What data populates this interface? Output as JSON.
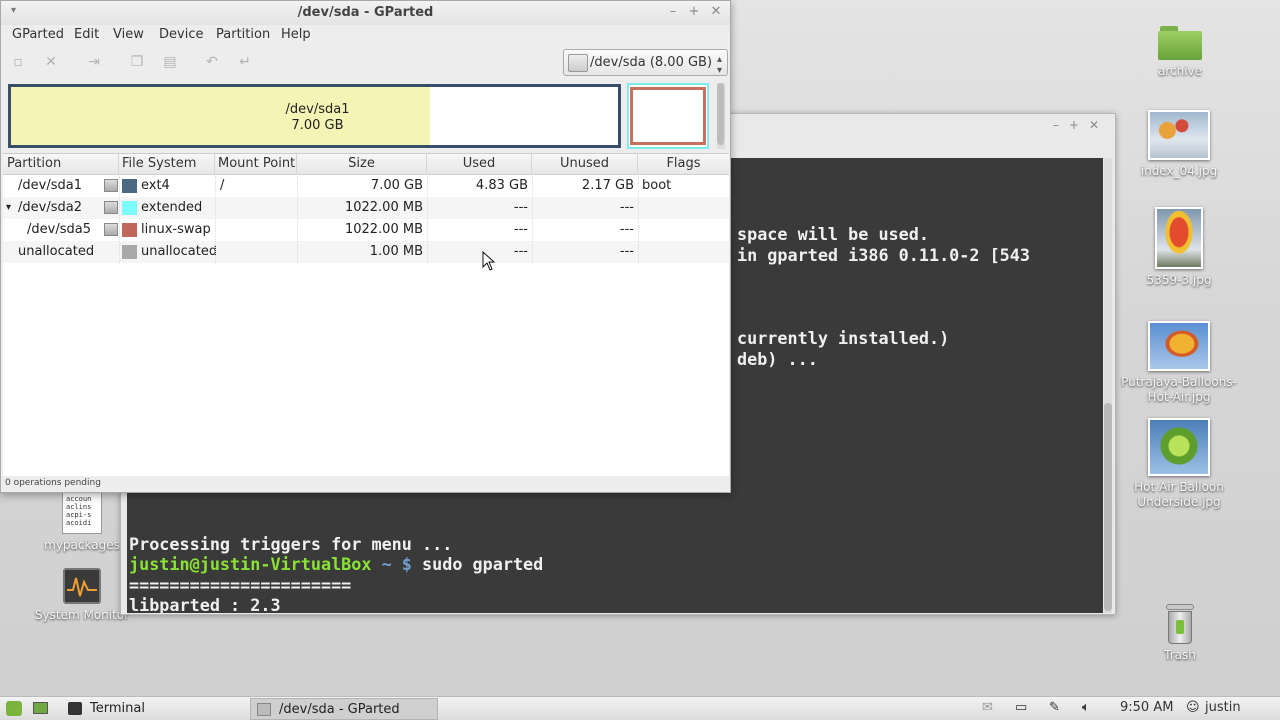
{
  "desktop": {
    "icons": [
      {
        "label": "archive",
        "icon": "folder-icon"
      },
      {
        "label": "index_04.jpg",
        "icon": "image-icon"
      },
      {
        "label": "5359-3.jpg",
        "icon": "image-icon"
      },
      {
        "label": "Putrajaya-Balloons-Hot-Air.jpg",
        "icon": "image-icon"
      },
      {
        "label": "Hot Air Balloon Underside.jpg",
        "icon": "image-icon"
      },
      {
        "label": "Trash",
        "icon": "trash-icon"
      },
      {
        "label": "mypackages",
        "icon": "text-file-icon"
      },
      {
        "label": "System Monitor",
        "icon": "system-monitor-icon"
      }
    ],
    "doc_thumb_lines": [
      "accoun",
      "aclins",
      "acpi-s",
      "acoidi"
    ]
  },
  "terminal": {
    "lines": [
      "space will be used.",
      "in gparted i386 0.11.0-2 [543",
      "",
      "currently installed.)",
      "deb) ..."
    ],
    "bottom_lines": [
      "Processing triggers for menu ...",
      "======================",
      "libparted : 2.3",
      "======================"
    ],
    "prompt_user": "justin@justin-VirtualBox",
    "prompt_path": "~ $",
    "prompt_command": " sudo gparted"
  },
  "gparted": {
    "title": "/dev/sda - GParted",
    "menu": [
      "GParted",
      "Edit",
      "View",
      "Device",
      "Partition",
      "Help"
    ],
    "device": "/dev/sda  (8.00 GB)",
    "map": {
      "sda1_name": "/dev/sda1",
      "sda1_size": "7.00 GB",
      "sda1_used_fraction": 0.69
    },
    "columns": [
      "Partition",
      "File System",
      "Mount Point",
      "Size",
      "Used",
      "Unused",
      "Flags"
    ],
    "rows": [
      {
        "partition": "/dev/sda1",
        "fs": "ext4",
        "fs_color": "#4b6983",
        "mount": "/",
        "size": "7.00 GB",
        "used": "4.83 GB",
        "unused": "2.17 GB",
        "flags": "boot",
        "expander": ""
      },
      {
        "partition": "/dev/sda2",
        "fs": "extended",
        "fs_color": "#7dfcfe",
        "mount": "",
        "size": "1022.00 MB",
        "used": "---",
        "unused": "---",
        "flags": "",
        "expander": "▾"
      },
      {
        "partition": "/dev/sda5",
        "fs": "linux-swap",
        "fs_color": "#c1665a",
        "mount": "",
        "size": "1022.00 MB",
        "used": "---",
        "unused": "---",
        "flags": "",
        "expander": ""
      },
      {
        "partition": "unallocated",
        "fs": "unallocated",
        "fs_color": "#a9a9a9",
        "mount": "",
        "size": "1.00 MB",
        "used": "---",
        "unused": "---",
        "flags": "",
        "expander": ""
      }
    ],
    "status": "0 operations pending"
  },
  "taskbar": {
    "items": [
      {
        "label": "Terminal",
        "icon": "terminal-icon"
      },
      {
        "label": "/dev/sda - GParted",
        "icon": "gparted-icon"
      }
    ],
    "clock": "9:50 AM",
    "user": "justin"
  }
}
